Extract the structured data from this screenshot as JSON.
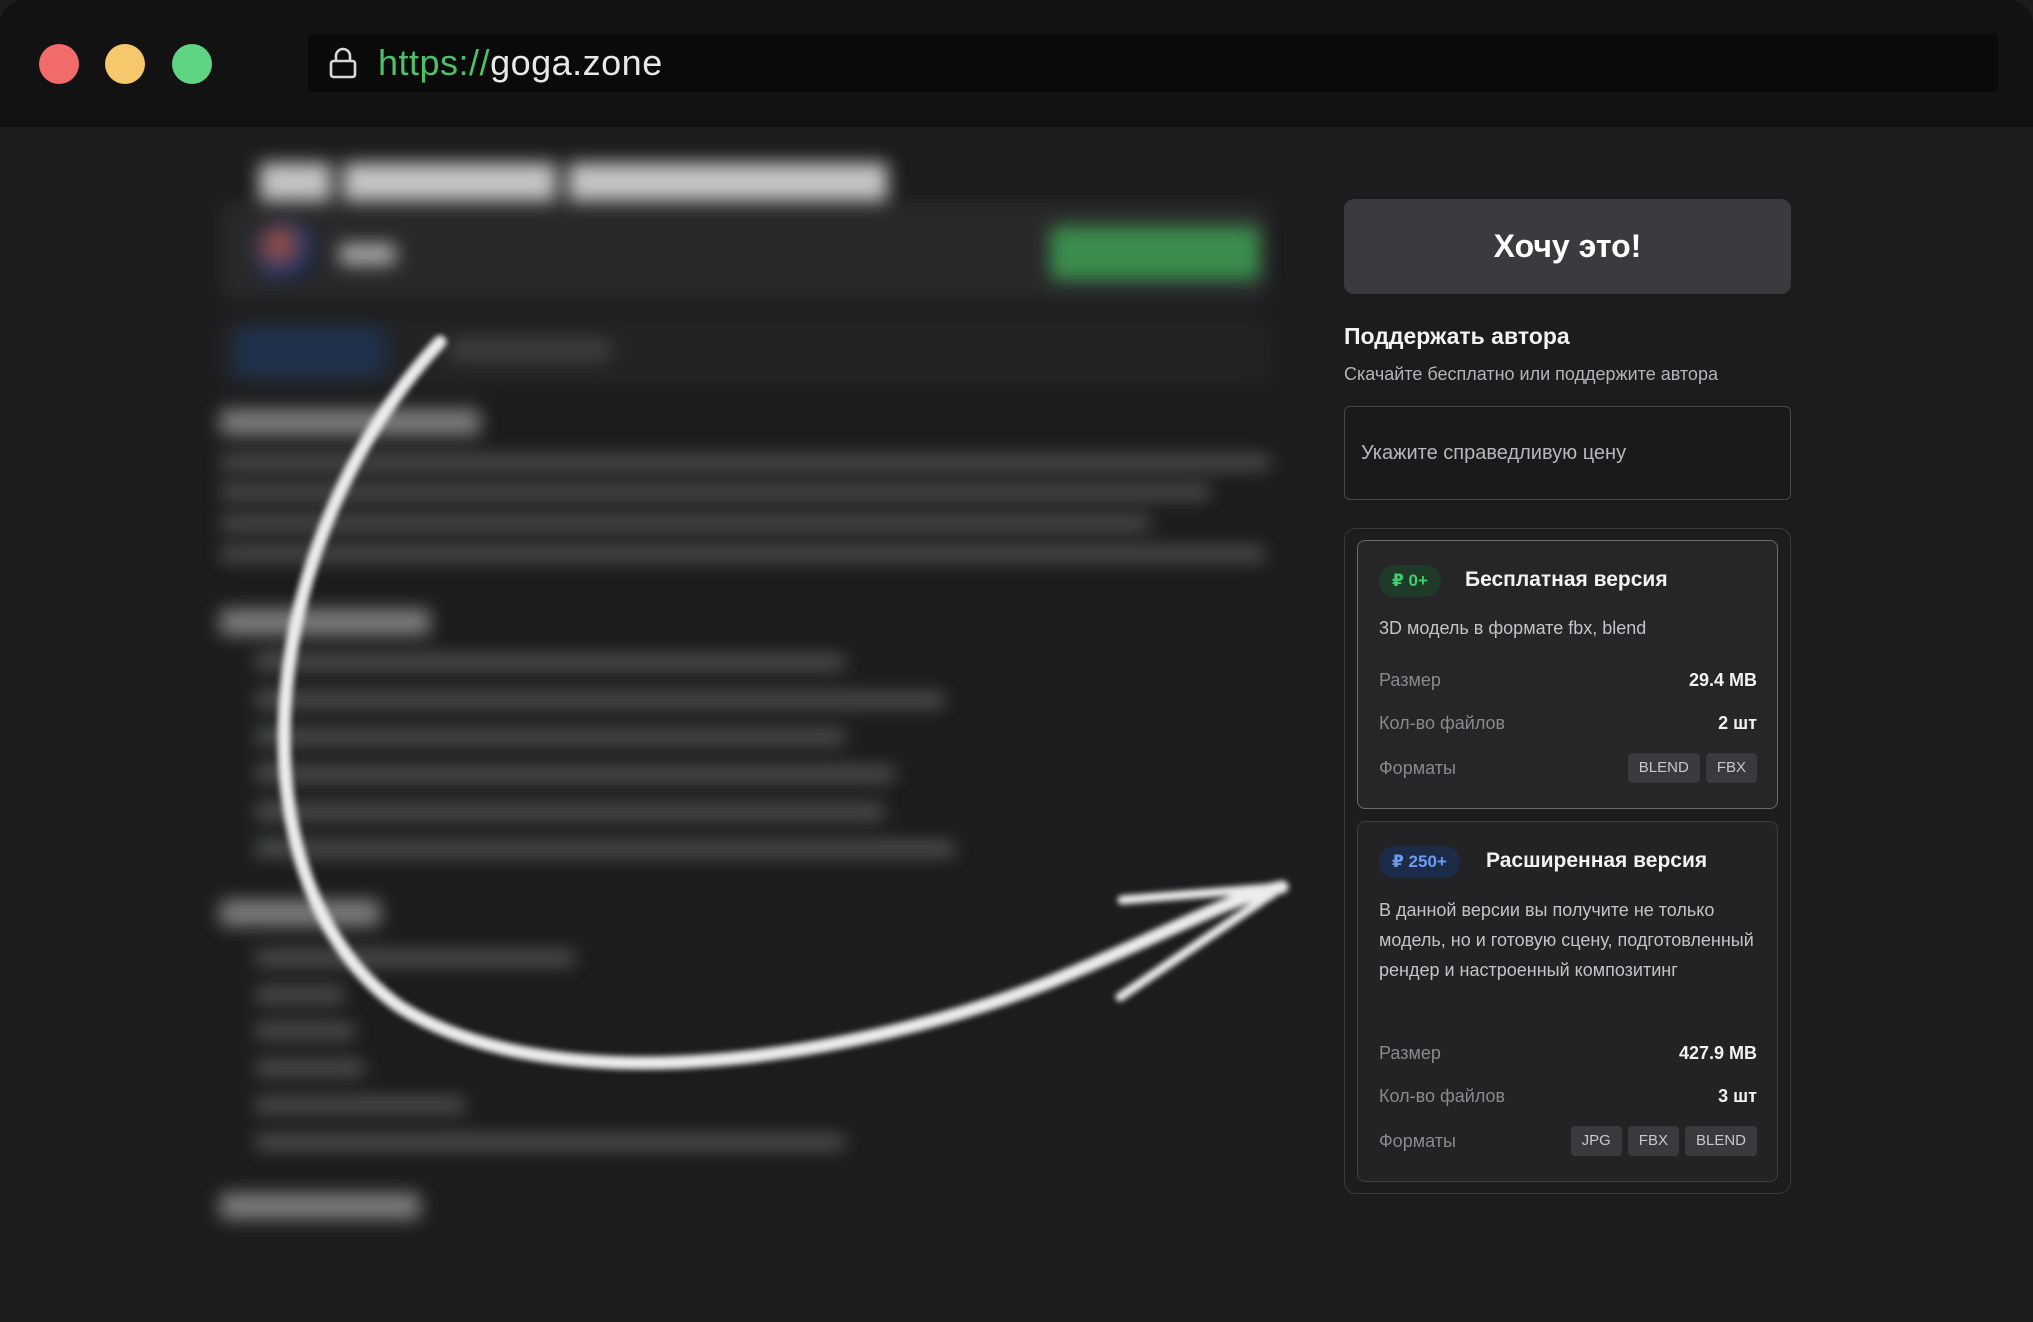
{
  "browser": {
    "url_scheme": "https://",
    "url_host": "goga.zone"
  },
  "sidebar": {
    "want_button_label": "Хочу это!",
    "support_title": "Поддержать автора",
    "support_subtitle": "Скачайте бесплатно или поддержите автора",
    "price_placeholder": "Укажите справедливую цену"
  },
  "versions": [
    {
      "badge": "₽ 0+",
      "title": "Бесплатная версия",
      "description": "3D модель в формате fbx, blend",
      "size_label": "Размер",
      "size_value": "29.4 MB",
      "files_label": "Кол-во файлов",
      "files_value": "2 шт",
      "formats_label": "Форматы",
      "formats": [
        "BLEND",
        "FBX"
      ]
    },
    {
      "badge": "₽ 250+",
      "title": "Расширенная версия",
      "description": "В данной версии вы получите не только модель, но и готовую сцену, подготовленный рендер и настроенный композитинг",
      "size_label": "Размер",
      "size_value": "427.9 MB",
      "files_label": "Кол-во файлов",
      "files_value": "3 шт",
      "formats_label": "Форматы",
      "formats": [
        "JPG",
        "FBX",
        "BLEND"
      ]
    }
  ],
  "colors": {
    "accent_green": "#3fcf6a",
    "accent_blue": "#6a9cf2",
    "background": "#1c1c1e"
  }
}
